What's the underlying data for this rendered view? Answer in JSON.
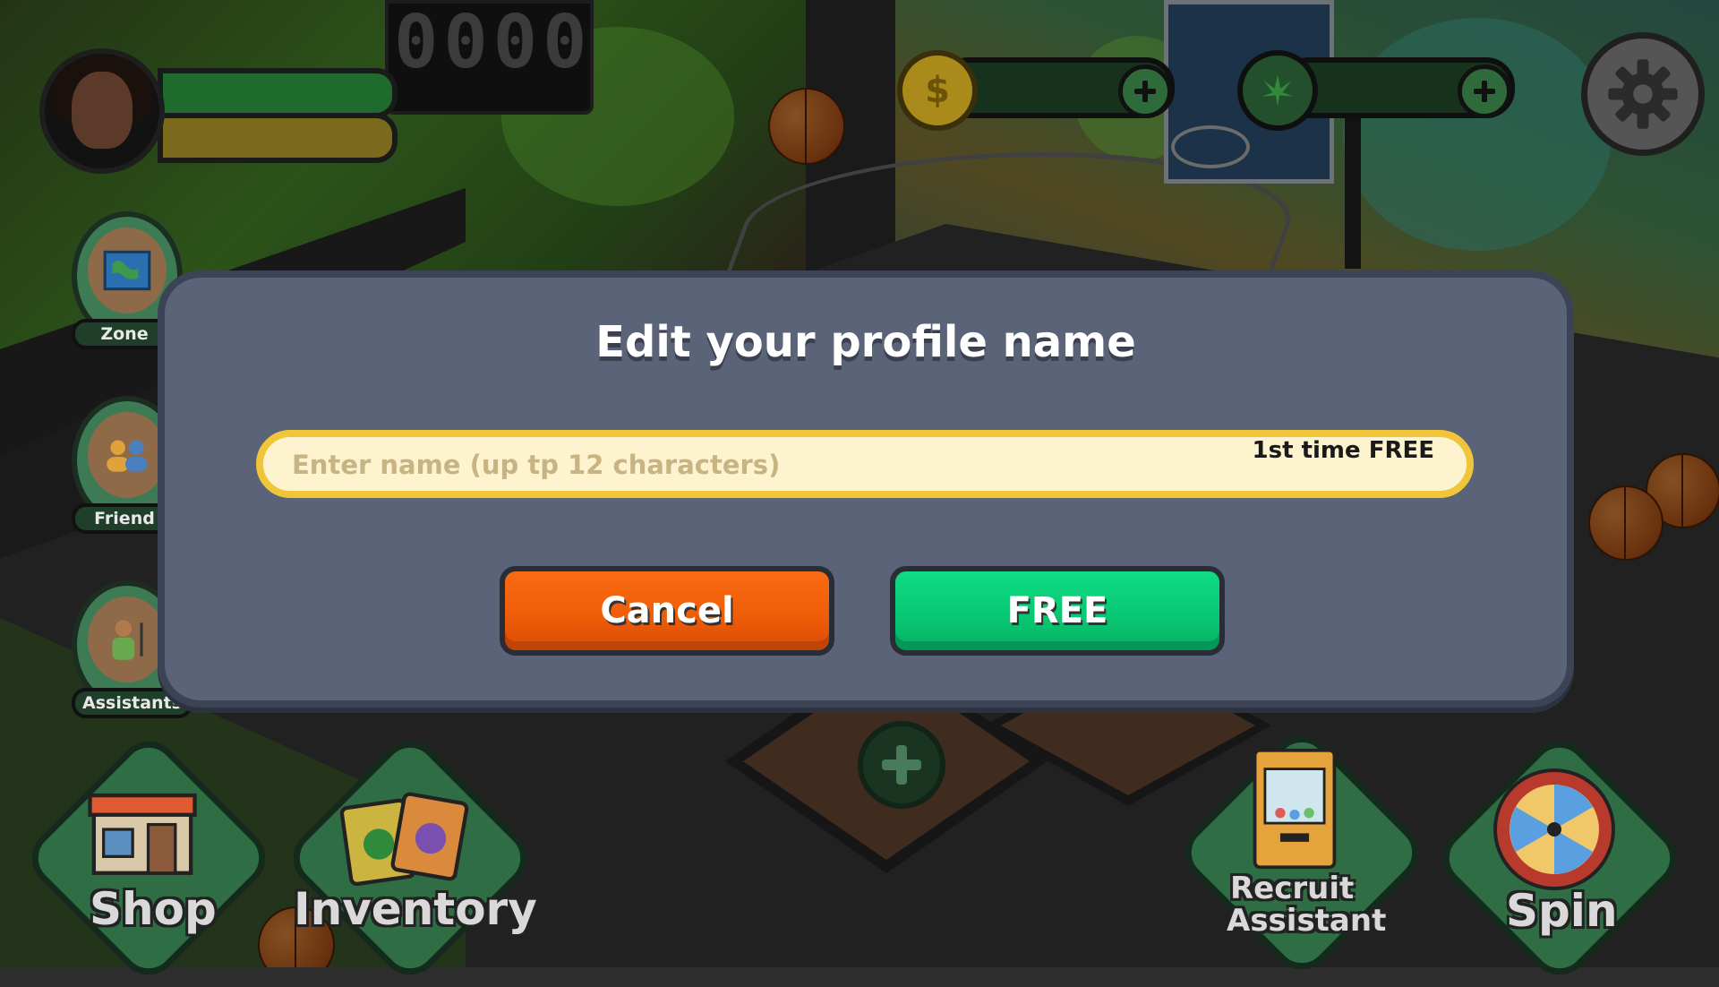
{
  "scoreboard": {
    "digits": "0000"
  },
  "hud": {
    "currency_cash_icon": "$",
    "currency_leaf_icon": "leaf-icon"
  },
  "side_menu": {
    "zone": "Zone",
    "friends": "Friend",
    "assistants": "Assistants"
  },
  "bottom_menu": {
    "shop": "Shop",
    "inventory": "Inventory",
    "recruit_line1": "Recruit",
    "recruit_line2": "Assistant",
    "spin": "Spin"
  },
  "dialog": {
    "title": "Edit your profile name",
    "input_placeholder": "Enter name (up tp 12 characters)",
    "input_value": "",
    "free_note": "1st time FREE",
    "cancel_label": "Cancel",
    "confirm_label": "FREE"
  },
  "colors": {
    "modal_bg": "#5a6377",
    "cancel": "#ef5d08",
    "confirm": "#08c873",
    "field_border": "#f0c53a"
  }
}
